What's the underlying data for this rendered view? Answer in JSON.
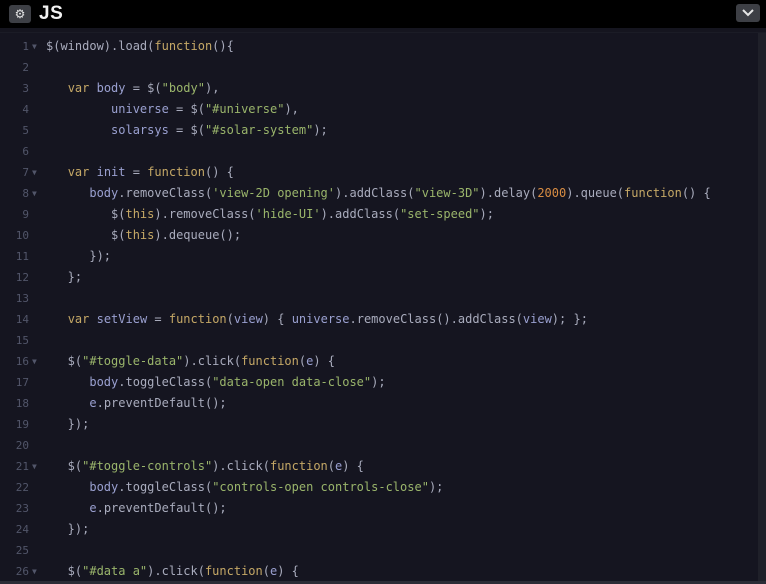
{
  "header": {
    "title": "JS",
    "settings_icon": "gear-icon",
    "collapse_icon": "chevron-down-icon"
  },
  "colors": {
    "background": "#15151f",
    "keyword": "#c5a866",
    "string": "#9ab56b",
    "number": "#d98d43",
    "variable": "#9aa0d0",
    "text": "#a9acbd"
  },
  "editor": {
    "lines": [
      {
        "n": "1",
        "fold": true,
        "tokens": [
          [
            "punc",
            "$(window).load("
          ],
          [
            "kw",
            "function"
          ],
          [
            "punc",
            "(){"
          ]
        ]
      },
      {
        "n": "2",
        "fold": false,
        "tokens": []
      },
      {
        "n": "3",
        "fold": false,
        "tokens": [
          [
            "punc",
            "   "
          ],
          [
            "kw",
            "var"
          ],
          [
            "var",
            " body"
          ],
          [
            "punc",
            " = $("
          ],
          [
            "str",
            "\"body\""
          ],
          [
            "punc",
            "),"
          ]
        ]
      },
      {
        "n": "4",
        "fold": false,
        "tokens": [
          [
            "punc",
            "         "
          ],
          [
            "var",
            "universe"
          ],
          [
            "punc",
            " = $("
          ],
          [
            "str",
            "\"#universe\""
          ],
          [
            "punc",
            "),"
          ]
        ]
      },
      {
        "n": "5",
        "fold": false,
        "tokens": [
          [
            "punc",
            "         "
          ],
          [
            "var",
            "solarsys"
          ],
          [
            "punc",
            " = $("
          ],
          [
            "str",
            "\"#solar-system\""
          ],
          [
            "punc",
            ");"
          ]
        ]
      },
      {
        "n": "6",
        "fold": false,
        "tokens": []
      },
      {
        "n": "7",
        "fold": true,
        "tokens": [
          [
            "punc",
            "   "
          ],
          [
            "kw",
            "var"
          ],
          [
            "var",
            " init"
          ],
          [
            "punc",
            " = "
          ],
          [
            "kw",
            "function"
          ],
          [
            "punc",
            "() {"
          ]
        ]
      },
      {
        "n": "8",
        "fold": true,
        "tokens": [
          [
            "punc",
            "      "
          ],
          [
            "var",
            "body"
          ],
          [
            "punc",
            ".removeClass("
          ],
          [
            "str",
            "'view-2D opening'"
          ],
          [
            "punc",
            ").addClass("
          ],
          [
            "str",
            "\"view-3D\""
          ],
          [
            "punc",
            ").delay("
          ],
          [
            "num",
            "2000"
          ],
          [
            "punc",
            ").queue("
          ],
          [
            "kw",
            "function"
          ],
          [
            "punc",
            "() {"
          ]
        ]
      },
      {
        "n": "9",
        "fold": false,
        "tokens": [
          [
            "punc",
            "         $("
          ],
          [
            "kw",
            "this"
          ],
          [
            "punc",
            ").removeClass("
          ],
          [
            "str",
            "'hide-UI'"
          ],
          [
            "punc",
            ").addClass("
          ],
          [
            "str",
            "\"set-speed\""
          ],
          [
            "punc",
            ");"
          ]
        ]
      },
      {
        "n": "10",
        "fold": false,
        "tokens": [
          [
            "punc",
            "         $("
          ],
          [
            "kw",
            "this"
          ],
          [
            "punc",
            ").dequeue();"
          ]
        ]
      },
      {
        "n": "11",
        "fold": false,
        "tokens": [
          [
            "punc",
            "      });"
          ]
        ]
      },
      {
        "n": "12",
        "fold": false,
        "tokens": [
          [
            "punc",
            "   };"
          ]
        ]
      },
      {
        "n": "13",
        "fold": false,
        "tokens": []
      },
      {
        "n": "14",
        "fold": false,
        "tokens": [
          [
            "punc",
            "   "
          ],
          [
            "kw",
            "var"
          ],
          [
            "var",
            " setView"
          ],
          [
            "punc",
            " = "
          ],
          [
            "kw",
            "function"
          ],
          [
            "punc",
            "("
          ],
          [
            "var",
            "view"
          ],
          [
            "punc",
            ") { "
          ],
          [
            "var",
            "universe"
          ],
          [
            "punc",
            ".removeClass().addClass("
          ],
          [
            "var",
            "view"
          ],
          [
            "punc",
            "); };"
          ]
        ]
      },
      {
        "n": "15",
        "fold": false,
        "tokens": []
      },
      {
        "n": "16",
        "fold": true,
        "tokens": [
          [
            "punc",
            "   $("
          ],
          [
            "str",
            "\"#toggle-data\""
          ],
          [
            "punc",
            ").click("
          ],
          [
            "kw",
            "function"
          ],
          [
            "punc",
            "("
          ],
          [
            "var",
            "e"
          ],
          [
            "punc",
            ") {"
          ]
        ]
      },
      {
        "n": "17",
        "fold": false,
        "tokens": [
          [
            "punc",
            "      "
          ],
          [
            "var",
            "body"
          ],
          [
            "punc",
            ".toggleClass("
          ],
          [
            "str",
            "\"data-open data-close\""
          ],
          [
            "punc",
            ");"
          ]
        ]
      },
      {
        "n": "18",
        "fold": false,
        "tokens": [
          [
            "punc",
            "      "
          ],
          [
            "var",
            "e"
          ],
          [
            "punc",
            ".preventDefault();"
          ]
        ]
      },
      {
        "n": "19",
        "fold": false,
        "tokens": [
          [
            "punc",
            "   });"
          ]
        ]
      },
      {
        "n": "20",
        "fold": false,
        "tokens": []
      },
      {
        "n": "21",
        "fold": true,
        "tokens": [
          [
            "punc",
            "   $("
          ],
          [
            "str",
            "\"#toggle-controls\""
          ],
          [
            "punc",
            ").click("
          ],
          [
            "kw",
            "function"
          ],
          [
            "punc",
            "("
          ],
          [
            "var",
            "e"
          ],
          [
            "punc",
            ") {"
          ]
        ]
      },
      {
        "n": "22",
        "fold": false,
        "tokens": [
          [
            "punc",
            "      "
          ],
          [
            "var",
            "body"
          ],
          [
            "punc",
            ".toggleClass("
          ],
          [
            "str",
            "\"controls-open controls-close\""
          ],
          [
            "punc",
            ");"
          ]
        ]
      },
      {
        "n": "23",
        "fold": false,
        "tokens": [
          [
            "punc",
            "      "
          ],
          [
            "var",
            "e"
          ],
          [
            "punc",
            ".preventDefault();"
          ]
        ]
      },
      {
        "n": "24",
        "fold": false,
        "tokens": [
          [
            "punc",
            "   });"
          ]
        ]
      },
      {
        "n": "25",
        "fold": false,
        "tokens": []
      },
      {
        "n": "26",
        "fold": true,
        "tokens": [
          [
            "punc",
            "   $("
          ],
          [
            "str",
            "\"#data a\""
          ],
          [
            "punc",
            ").click("
          ],
          [
            "kw",
            "function"
          ],
          [
            "punc",
            "("
          ],
          [
            "var",
            "e"
          ],
          [
            "punc",
            ") {"
          ]
        ]
      }
    ]
  }
}
